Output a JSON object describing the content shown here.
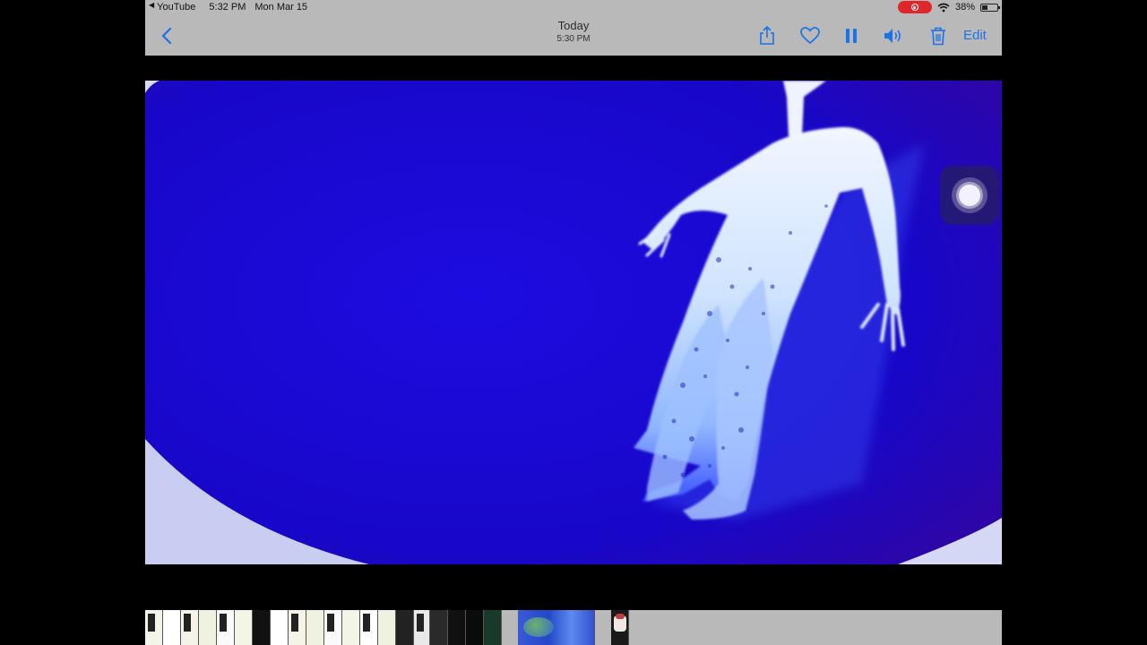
{
  "status_bar": {
    "back_app": "YouTube",
    "time": "5:32 PM",
    "date": "Mon Mar 15",
    "battery": "38%",
    "battery_level": 0.38
  },
  "nav": {
    "title": "Today",
    "subtitle": "5:30 PM",
    "edit_label": "Edit"
  },
  "icons": {
    "back": "chevron-left-icon",
    "share": "share-icon",
    "favorite": "heart-icon",
    "pause": "pause-icon",
    "sound": "speaker-icon",
    "delete": "trash-icon",
    "assistive": "assistive-touch-icon"
  },
  "colors": {
    "accent": "#1a73e8",
    "bar_bg": "#b9b9b9",
    "record": "#e0262b",
    "media_blue": "#1a06c8"
  }
}
